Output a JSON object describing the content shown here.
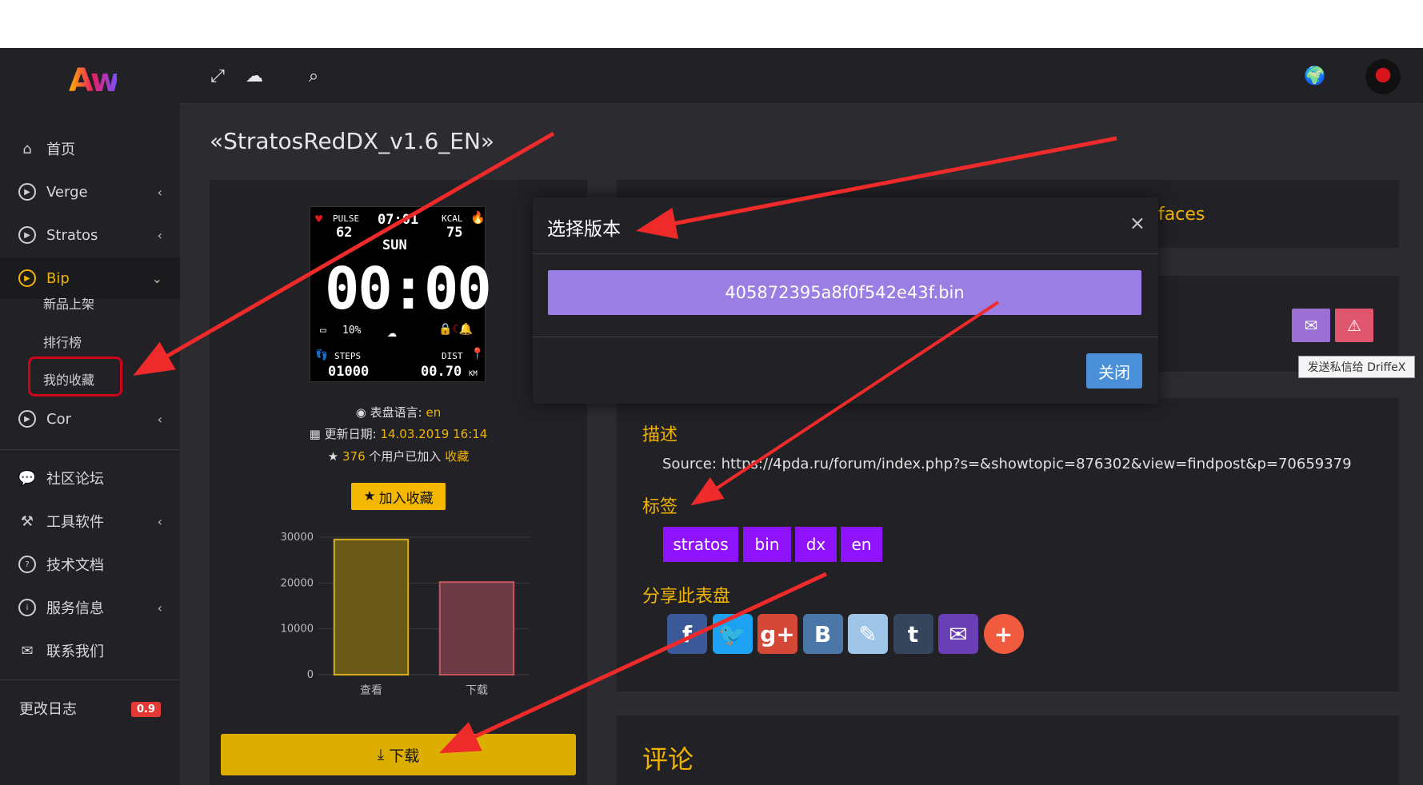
{
  "logo": "Aw",
  "sidebar": {
    "items": [
      {
        "label": "首页",
        "icon": "home-icon"
      },
      {
        "label": "Verge",
        "icon": "play-circle-icon"
      },
      {
        "label": "Stratos",
        "icon": "play-circle-icon"
      },
      {
        "label": "Bip",
        "icon": "play-circle-icon"
      },
      {
        "label": "Cor",
        "icon": "play-circle-icon"
      }
    ],
    "sub_items": [
      "新品上架",
      "排行榜",
      "我的收藏"
    ],
    "items2": [
      {
        "label": "社区论坛",
        "icon": "chat-icon"
      },
      {
        "label": "工具软件",
        "icon": "hammer-icon"
      },
      {
        "label": "技术文档",
        "icon": "question-circle-icon"
      },
      {
        "label": "服务信息",
        "icon": "info-circle-icon"
      },
      {
        "label": "联系我们",
        "icon": "mail-icon"
      }
    ],
    "changelog": {
      "label": "更改日志",
      "badge": "0.9"
    }
  },
  "page": {
    "title": "«StratosRedDX_v1.6_EN»"
  },
  "watch": {
    "pulse_label": "PULSE",
    "pulse": "62",
    "time_small": "07:01",
    "kcal_label": "KCAL",
    "kcal": "75",
    "day": "SUN",
    "time": "00:00",
    "battery": "10%",
    "steps_label": "STEPS",
    "steps": "01000",
    "dist_label": "DIST",
    "dist": "00.70",
    "dist_unit": "KM"
  },
  "meta": {
    "language_label": "表盘语言:",
    "language": "en",
    "date_label": "更新日期:",
    "date": "14.03.2019 16:14",
    "fav_count": "376",
    "fav_text": "个用户已加入",
    "fav_link": "收藏"
  },
  "fav_button": "加入收藏",
  "download_button": "下载",
  "chart_data": {
    "type": "bar",
    "categories": [
      "查看",
      "下载"
    ],
    "values": [
      29500,
      20200
    ],
    "ylim": [
      0,
      30000
    ],
    "yticks": [
      0,
      10000,
      20000,
      30000
    ],
    "colors": {
      "fill": [
        "#6b5a17",
        "#6b3a44"
      ],
      "stroke": [
        "#d8ae1e",
        "#c9555f"
      ]
    }
  },
  "right": {
    "faces_text": "faces",
    "desc_title": "描述",
    "desc": "Source: https://4pda.ru/forum/index.php?s=&showtopic=876302&view=findpost&p=70659379",
    "tags_title": "标签",
    "tags": [
      "stratos",
      "bin",
      "dx",
      "en"
    ],
    "share_title": "分享此表盘",
    "share": [
      {
        "glyph": "f",
        "color": "#3b5998",
        "icon": "facebook-icon"
      },
      {
        "glyph": "🐦",
        "color": "#1da1f2",
        "icon": "twitter-icon"
      },
      {
        "glyph": "g+",
        "color": "#d34836",
        "icon": "google-plus-icon"
      },
      {
        "glyph": "B",
        "color": "#4a76a8",
        "icon": "vk-icon"
      },
      {
        "glyph": "✎",
        "color": "#9ec5e8",
        "icon": "livejournal-icon"
      },
      {
        "glyph": "t",
        "color": "#35465c",
        "icon": "tumblr-icon"
      },
      {
        "glyph": "✉",
        "color": "#6a3fb5",
        "icon": "email-icon"
      },
      {
        "glyph": "+",
        "color": "#f05a3e",
        "icon": "more-icon"
      }
    ],
    "comments_title": "评论",
    "tooltip": "发送私信给 DriffeX"
  },
  "modal": {
    "title": "选择版本",
    "file": "405872395a8f0f542e43f.bin",
    "close_label": "关闭"
  }
}
